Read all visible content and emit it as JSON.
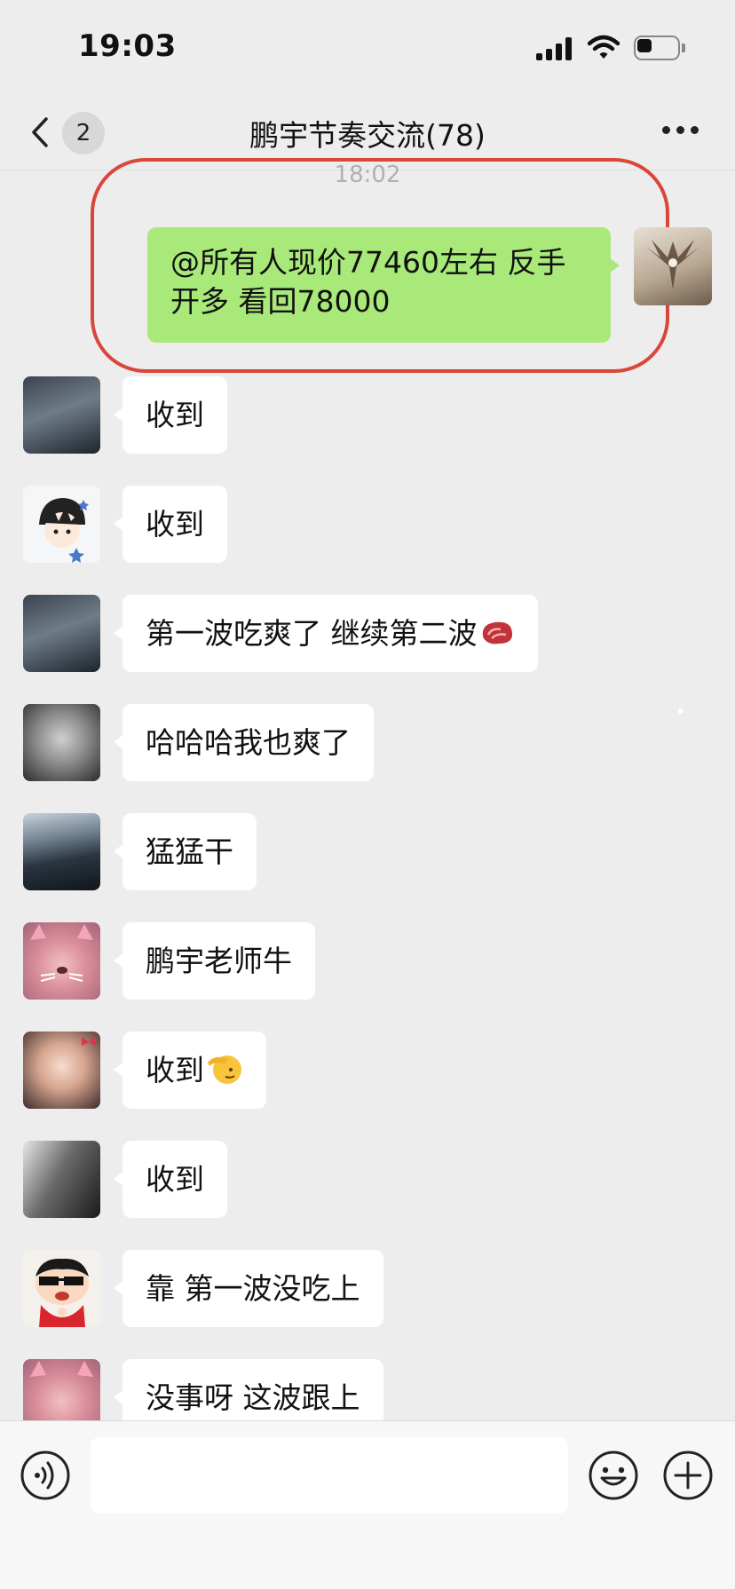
{
  "status_bar": {
    "time": "19:03"
  },
  "nav": {
    "back_icon": "chevron-left-icon",
    "unread_count": "2",
    "title": "鹏宇节奏交流(78)",
    "more_icon": "more-icon"
  },
  "timestamp": "18:02",
  "my_message": {
    "text": "@所有人现价77460左右 反手开多 看回78000"
  },
  "messages": [
    {
      "avatar": "dark-scene-avatar",
      "text": "收到"
    },
    {
      "avatar": "anime-boy-avatar",
      "text": "收到"
    },
    {
      "avatar": "dark-scene-avatar",
      "text": "第一波吃爽了 继续第二波",
      "emoji": "meat-emoji"
    },
    {
      "avatar": "man-portrait-avatar",
      "text": "哈哈哈我也爽了"
    },
    {
      "avatar": "seashore-avatar",
      "text": "猛猛干"
    },
    {
      "avatar": "cat-filter-avatar",
      "text": "鹏宇老师牛"
    },
    {
      "avatar": "girl-portrait-avatar",
      "text": "收到",
      "emoji": "salute-emoji"
    },
    {
      "avatar": "couple-photo-avatar",
      "text": "收到"
    },
    {
      "avatar": "cartoon-sunglasses-avatar",
      "text": "靠 第一波没吃上"
    },
    {
      "avatar": "cat-filter-avatar",
      "text": "没事呀  这波跟上"
    }
  ],
  "input_bar": {
    "voice_icon": "voice-icon",
    "emoji_icon": "emoji-icon",
    "plus_icon": "plus-icon",
    "placeholder": ""
  },
  "colors": {
    "background": "#ededed",
    "my_bubble": "#a9e97a",
    "incoming_bubble": "#ffffff",
    "highlight": "#d9463b"
  }
}
